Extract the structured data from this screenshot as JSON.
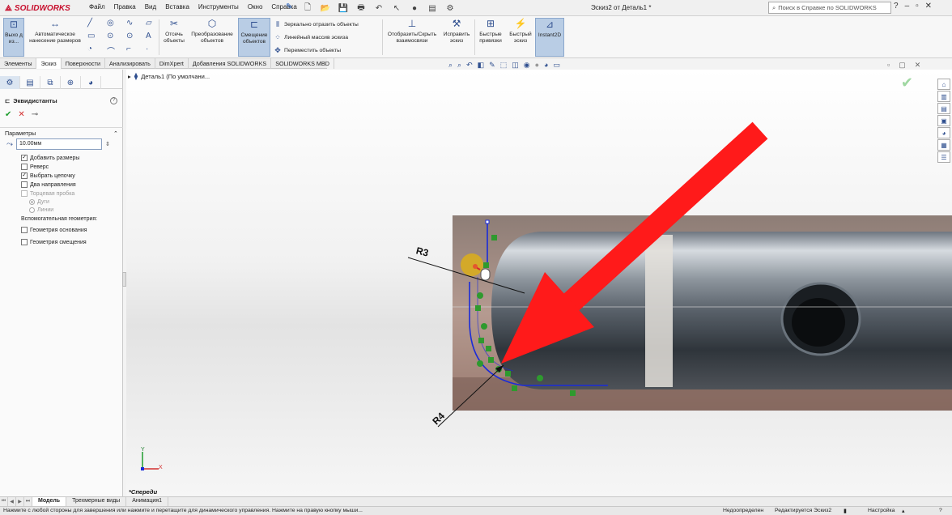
{
  "app": {
    "logo_text": "SOLIDWORKS",
    "document_title": "Эскиз2 от Деталь1 *",
    "menu": [
      "Файл",
      "Правка",
      "Вид",
      "Вставка",
      "Инструменты",
      "Окно",
      "Справка"
    ],
    "help_search_placeholder": "Поиск в Справке по SOLIDWORKS"
  },
  "ribbon": {
    "exit_sketch": "Выхо д из...",
    "smart_dimension": "Автоматическое нанесение размеров",
    "trim": "Отсечь объекты",
    "convert": "Преобразование объектов",
    "offset": "Смещение объектов",
    "mirror": "Зеркально отразить объекты",
    "linear_pattern": "Линейный массив эскиза",
    "move": "Переместить объекты",
    "display_relations": "Отобразить/Скрыть взаимосвязи",
    "repair": "Исправить эскиз",
    "quick_snaps": "Быстрые привязки",
    "rapid_sketch": "Быстрый эскиз",
    "instant2d": "Instant2D"
  },
  "tabs": [
    "Элементы",
    "Эскиз",
    "Поверхности",
    "Анализировать",
    "DimXpert",
    "Добавления SOLIDWORKS",
    "SOLIDWORKS MBD"
  ],
  "active_tab": "Эскиз",
  "property_manager": {
    "title": "Эквидистанты",
    "section": "Параметры",
    "distance": "10.00мм",
    "options": [
      {
        "label": "Добавить размеры",
        "checked": true,
        "enabled": true
      },
      {
        "label": "Реверс",
        "checked": false,
        "enabled": true
      },
      {
        "label": "Выбрать цепочку",
        "checked": true,
        "enabled": true
      },
      {
        "label": "Два направления",
        "checked": false,
        "enabled": true
      },
      {
        "label": "Торцевая пробка",
        "checked": false,
        "enabled": false
      }
    ],
    "cap_types": [
      {
        "label": "Дуги",
        "selected": true
      },
      {
        "label": "Линии",
        "selected": false
      }
    ],
    "helper_geometry_label": "Вспомогательная геометрия:",
    "helper_options": [
      {
        "label": "Геометрия основания",
        "checked": false
      },
      {
        "label": "Геометрия смещения",
        "checked": false
      }
    ]
  },
  "graphics": {
    "tree_item": "Деталь1  (По умолчани...",
    "view_name": "*Спереди",
    "annotations": [
      "R3",
      "R4"
    ],
    "triad": {
      "x": "X",
      "y": "Y"
    }
  },
  "bottom_tabs": [
    "Модель",
    "Трехмерные виды",
    "Анимация1"
  ],
  "status": {
    "hint": "Нажмите с любой стороны для завершения или нажмите и перетащите для динамического управления.  Нажмите на правую кнопку мыши...",
    "defined": "Недоопределен",
    "editing": "Редактируется Эскиз2",
    "settings": "Настройка"
  },
  "colors": {
    "arrow": "#ff1a1a",
    "sketch_line": "#1a2bd9",
    "relation_marker": "#2e9a2e",
    "logo": "#c8102e"
  }
}
